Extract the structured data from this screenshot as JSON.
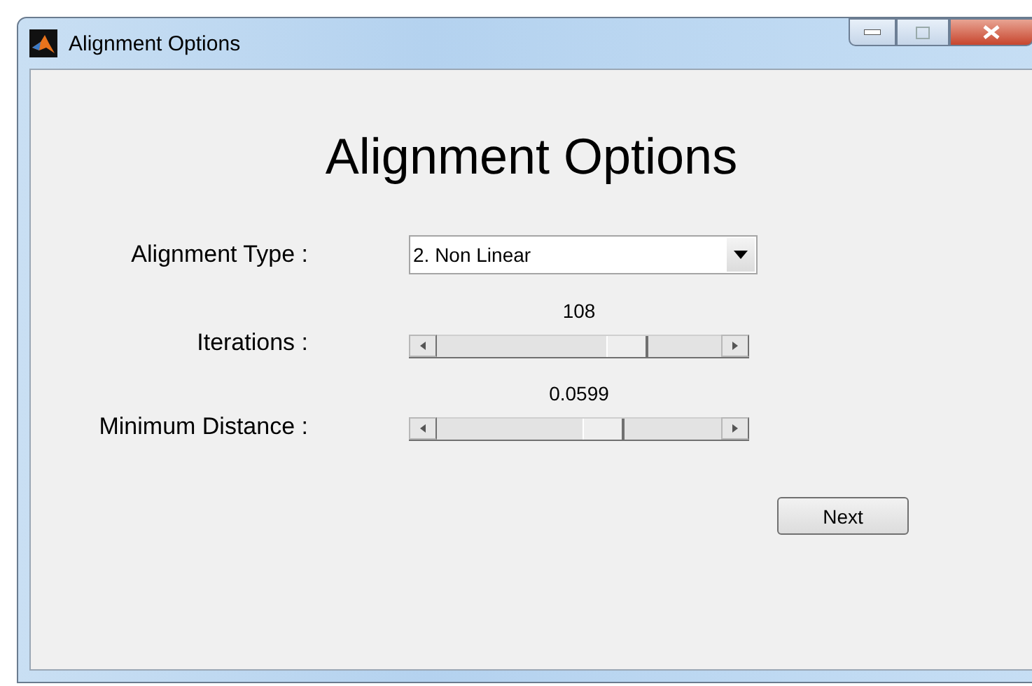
{
  "window": {
    "title": "Alignment Options"
  },
  "heading": "Alignment Options",
  "alignment_type": {
    "label": "Alignment Type :",
    "value": "2. Non Linear"
  },
  "sliders": [
    {
      "label": "Iterations :",
      "reading": "108",
      "level": 0.7
    },
    {
      "label": "Minimum Distance :",
      "reading": "0.0599",
      "level": 0.6
    }
  ],
  "buttons": [
    {
      "label": "Next"
    }
  ]
}
